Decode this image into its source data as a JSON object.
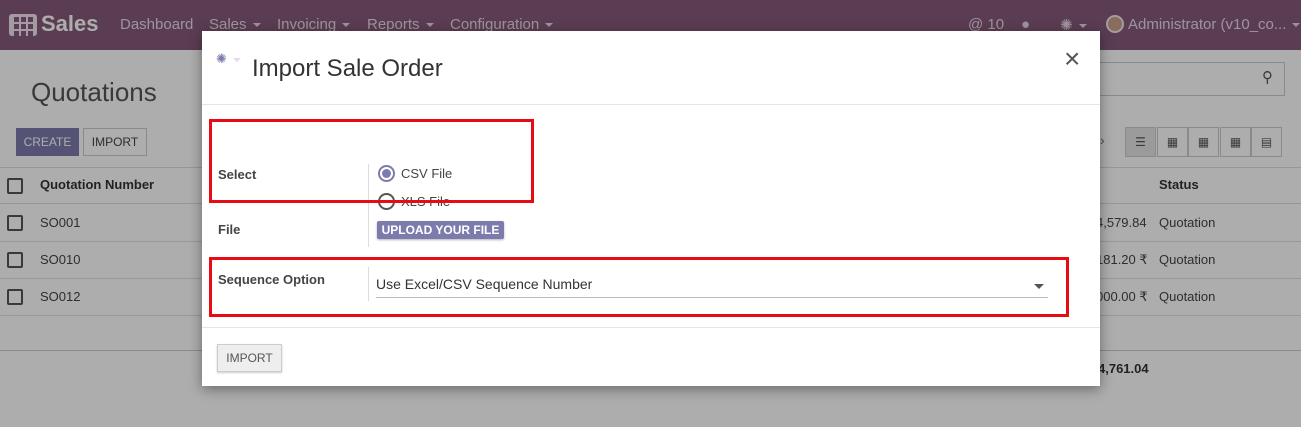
{
  "navbar": {
    "brand": "Sales",
    "menu": [
      "Dashboard",
      "Sales",
      "Invoicing",
      "Reports",
      "Configuration"
    ],
    "mentions": "@ 10",
    "user": "Administrator (v10_co..."
  },
  "page": {
    "title": "Quotations",
    "create_label": "CREATE",
    "import_label": "IMPORT",
    "columns": {
      "number": "Quotation Number",
      "status": "Status"
    },
    "rows": [
      {
        "number": "SO001",
        "amount": "4,579.84",
        "status": "Quotation"
      },
      {
        "number": "SO010",
        "amount": "181.20 ₹",
        "status": "Quotation"
      },
      {
        "number": "SO012",
        "amount": "000.00 ₹",
        "status": "Quotation"
      }
    ],
    "total": "4,761.04"
  },
  "modal": {
    "title": "Import Sale Order",
    "select_label": "Select",
    "options": [
      "CSV File",
      "XLS File"
    ],
    "selected_option": "CSV File",
    "file_label": "File",
    "upload_label": "UPLOAD YOUR FILE",
    "sequence_label": "Sequence Option",
    "sequence_value": "Use Excel/CSV Sequence Number",
    "import_button": "IMPORT",
    "close_glyph": "×"
  },
  "colors": {
    "navbar": "#875a7b",
    "primary": "#7c7bad",
    "highlight": "#e80b14"
  },
  "icons": [
    "apps-icon",
    "search-icon",
    "chat-icon",
    "bug-icon",
    "close-icon",
    "list-view-icon",
    "kanban-view-icon",
    "calendar-view-icon",
    "pivot-view-icon",
    "graph-view-icon"
  ]
}
